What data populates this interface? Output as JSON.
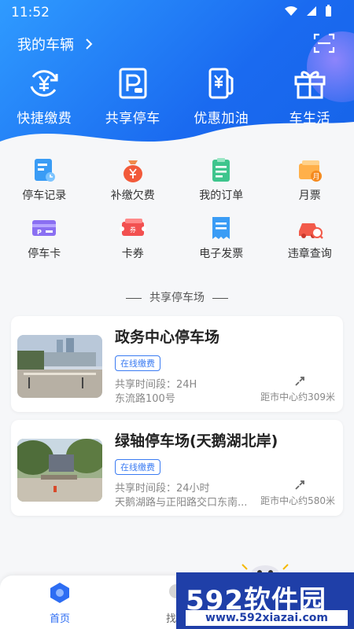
{
  "status_bar": {
    "time": "11:52"
  },
  "header": {
    "vehicle_label": "我的车辆",
    "quick_actions": [
      {
        "label": "快捷缴费",
        "icon": "yuan-refresh-icon"
      },
      {
        "label": "共享停车",
        "icon": "parking-icon"
      },
      {
        "label": "优惠加油",
        "icon": "fuel-pump-icon"
      },
      {
        "label": "车生活",
        "icon": "gift-icon"
      }
    ]
  },
  "services": [
    {
      "label": "停车记录",
      "icon": "parking-record-icon"
    },
    {
      "label": "补缴欠费",
      "icon": "money-bag-icon"
    },
    {
      "label": "我的订单",
      "icon": "order-clipboard-icon"
    },
    {
      "label": "月票",
      "icon": "monthly-ticket-icon"
    },
    {
      "label": "停车卡",
      "icon": "parking-card-icon"
    },
    {
      "label": "卡券",
      "icon": "coupon-icon"
    },
    {
      "label": "电子发票",
      "icon": "invoice-icon"
    },
    {
      "label": "违章查询",
      "icon": "violation-query-icon"
    }
  ],
  "section_title": "共享停车场",
  "lots": [
    {
      "name": "政务中心停车场",
      "badge": "在线缴费",
      "hours": "共享时间段：24H",
      "address": "东流路100号",
      "distance": "距市中心约309米"
    },
    {
      "name": "绿轴停车场(天鹅湖北岸)",
      "badge": "在线缴费",
      "hours": "共享时间段：24小时",
      "address": "天鹅湖路与正阳路交口东南...",
      "distance": "距市中心约580米"
    }
  ],
  "bottom_nav": {
    "home": "首页",
    "find": "找车"
  },
  "watermark": {
    "logo": "592软件园",
    "url": "www.592xiazai.com"
  },
  "colors": {
    "primary": "#1a6af0",
    "accent_blue": "#2d6df3",
    "badge_blue": "#3a7bf2"
  }
}
